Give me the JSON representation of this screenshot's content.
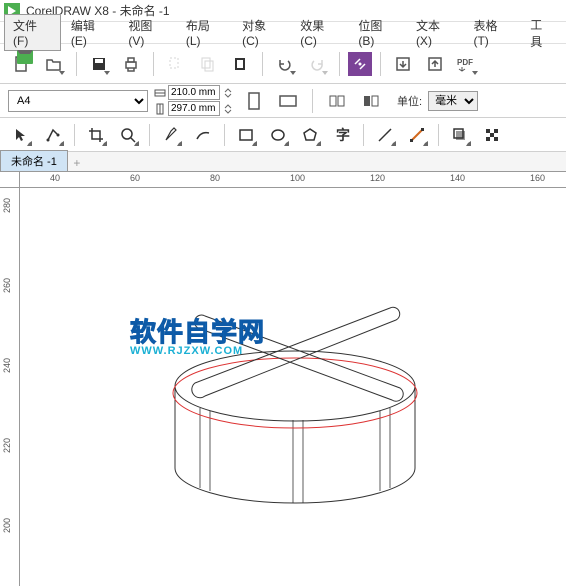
{
  "title": "CorelDRAW X8 - 未命名 -1",
  "menubar": {
    "file": "文件(F)",
    "edit": "编辑(E)",
    "view": "视图(V)",
    "layout": "布局(L)",
    "object": "对象(C)",
    "effects": "效果(C)",
    "bitmap": "位图(B)",
    "text": "文本(X)",
    "table": "表格(T)",
    "tools": "工具"
  },
  "propbar": {
    "page_size": "A4",
    "width": "210.0 mm",
    "height": "297.0 mm",
    "unit_label": "单位:",
    "unit_value": "毫米"
  },
  "tabs": {
    "doc1": "未命名 -1",
    "add": "+"
  },
  "ruler_h": [
    "40",
    "60",
    "80",
    "100",
    "120",
    "140",
    "160"
  ],
  "ruler_v": [
    "280",
    "260",
    "240",
    "220",
    "200"
  ],
  "watermark": {
    "cn": "软件自学网",
    "en": "WWW.RJZXW.COM"
  }
}
